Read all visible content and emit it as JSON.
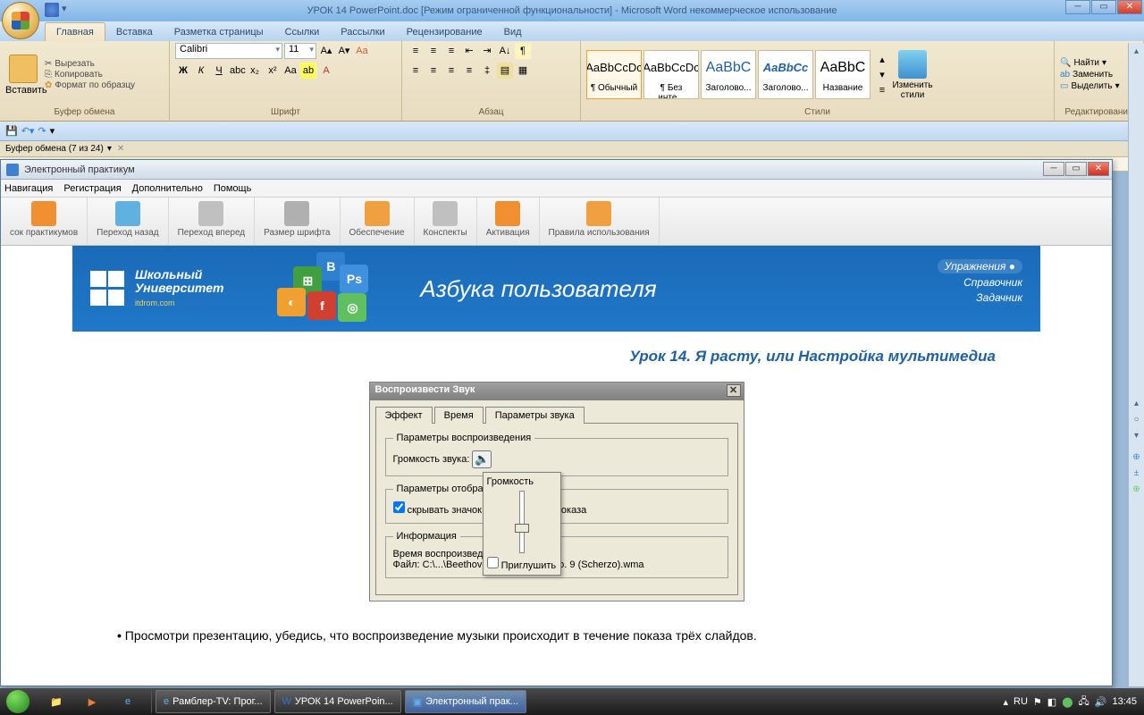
{
  "word": {
    "title": "УРОК 14 PowerPoint.doc [Режим ограниченной функциональности] - Microsoft Word некоммерческое использование",
    "tabs": [
      "Главная",
      "Вставка",
      "Разметка страницы",
      "Ссылки",
      "Рассылки",
      "Рецензирование",
      "Вид"
    ],
    "groups": {
      "clipboard": {
        "label": "Буфер обмена",
        "paste": "Вставить",
        "cut": "Вырезать",
        "copy": "Копировать",
        "format": "Формат по образцу"
      },
      "font": {
        "label": "Шрифт",
        "name": "Calibri",
        "size": "11"
      },
      "para": {
        "label": "Абзац"
      },
      "styles": {
        "label": "Стили",
        "items": [
          {
            "prev": "AaBbCcDc",
            "name": "¶ Обычный",
            "sel": true
          },
          {
            "prev": "AaBbCcDc",
            "name": "¶ Без инте..."
          },
          {
            "prev": "AaBbC",
            "name": "Заголово..."
          },
          {
            "prev": "AaBbCc",
            "name": "Заголово...",
            "italic": true,
            "bold": true
          },
          {
            "prev": "AaBbC",
            "name": "Название"
          }
        ],
        "change": "Изменить стили"
      },
      "edit": {
        "label": "Редактирование",
        "find": "Найти",
        "replace": "Заменить",
        "select": "Выделить"
      }
    },
    "clipboard_bar": "Буфер обмена (7 из 24)"
  },
  "practicum": {
    "title": "Электронный практикум",
    "menu": [
      "Навигация",
      "Регистрация",
      "Дополнительно",
      "Помощь"
    ],
    "toolbar": [
      {
        "label": "сок практикумов",
        "color": "#f09030"
      },
      {
        "label": "Переход назад",
        "color": "#60b0e0"
      },
      {
        "label": "Переход вперед",
        "color": "#b0b0b0"
      },
      {
        "label": "Размер шрифта",
        "color": "#a0a0a0"
      },
      {
        "label": "Обеспечение",
        "color": "#f0a040"
      },
      {
        "label": "Конспекты",
        "color": "#b0b0b0"
      },
      {
        "label": "Активация",
        "color": "#f09030"
      },
      {
        "label": "Правила использования",
        "color": "#f0a040"
      }
    ],
    "banner": {
      "uni1": "Школьный",
      "uni2": "Университет",
      "sub": "itdrom.com",
      "title": "Азбука пользователя",
      "links": [
        "Упражнения",
        "Справочник",
        "Задачник"
      ]
    },
    "lesson_title": "Урок 14. Я расту, или Настройка мультимедиа",
    "dialog": {
      "title": "Воспроизвести Звук",
      "tabs": [
        "Эффект",
        "Время",
        "Параметры звука"
      ],
      "g1": "Параметры воспроизведения",
      "g1_vol": "Громкость звука:",
      "g2": "Параметры отображения",
      "g2_cb": "скрывать значок звука во время показа",
      "g3": "Информация",
      "g3_time": "Время воспроизведения:",
      "g3_file": "Файл:",
      "g3_path": "C:\\...\\Beethoven's Symphony No. 9 (Scherzo).wma",
      "popup": "Громкость",
      "mute": "Приглушить"
    },
    "bullet": "Просмотри презентацию, убедись, что воспроизведение музыки происходит в течение показа трёх слайдов."
  },
  "taskbar": {
    "items": [
      {
        "label": "Рамблер-TV: Прог..."
      },
      {
        "label": "УРОК 14 PowerPoin..."
      },
      {
        "label": "Электронный прак...",
        "active": true
      }
    ],
    "lang": "RU",
    "time": "13:45"
  }
}
